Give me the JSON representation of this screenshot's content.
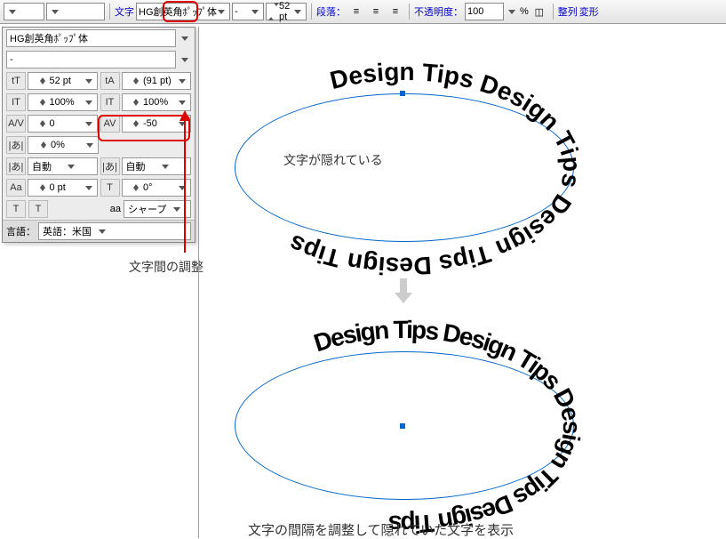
{
  "topbar": {
    "char_label": "文字",
    "font": "HG創英角ﾎﾟｯﾌﾟ体",
    "style": "-",
    "size": "52 pt",
    "para_label": "段落：",
    "opacity_label": "不透明度：",
    "opacity": "100",
    "pct": "%",
    "arrange": "整列",
    "transform": "変形"
  },
  "panel": {
    "font": "HG創英角ﾎﾟｯﾌﾟ体",
    "style": "-",
    "size": "52 pt",
    "leading": "(91 pt)",
    "vscale": "100%",
    "hscale": "100%",
    "kerning": "0",
    "tracking": "-50",
    "tsume": "0%",
    "baseline_auto1": "自動",
    "baseline_auto2": "自動",
    "baseline_shift": "0 pt",
    "rotation": "0°",
    "aa": "シャープ",
    "lang_label": "言語：",
    "lang": "英語：米国"
  },
  "icons": {
    "size": "tT",
    "leading": "tA",
    "vscale": "IT",
    "hscale": "IT",
    "kern": "A/V",
    "track": "AV",
    "tsume": "|あ|",
    "auto1": "|あ|",
    "auto2": "|あ|",
    "shift": "Aa",
    "rot": "T",
    "caps": "T",
    "T": "T",
    "aa": "aa"
  },
  "notes": {
    "tracking": "文字間の調整",
    "hidden": "文字が隠れている",
    "result": "文字の間隔を調整して隠れていた文字を表示"
  },
  "text_on_path": "Design Tips Design Tips Design Tips Design Tips"
}
